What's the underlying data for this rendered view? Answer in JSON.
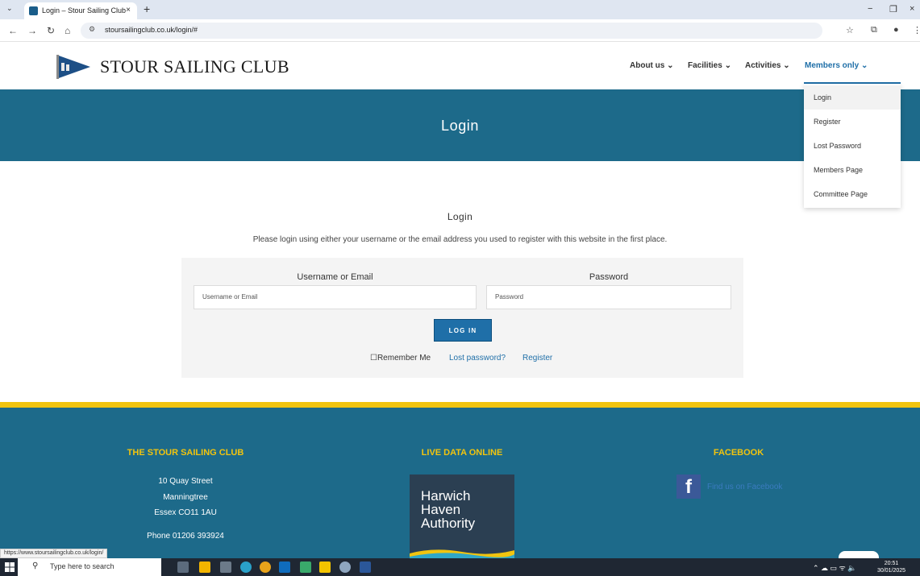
{
  "browser": {
    "tab_title": "Login – Stour Sailing Club",
    "tab_close": "×",
    "new_tab": "+",
    "url": "stoursailingclub.co.uk/login/#",
    "status_url": "https://www.stoursailingclub.co.uk/login/"
  },
  "site": {
    "logo_text": "STOUR SAILING CLUB",
    "nav": [
      {
        "label": "About us ⌄"
      },
      {
        "label": "Facilities ⌄"
      },
      {
        "label": "Activities ⌄"
      },
      {
        "label": "Members only ⌄"
      }
    ],
    "dropdown": [
      "Login",
      "Register",
      "Lost Password",
      "Members Page",
      "Committee Page"
    ],
    "hero_title": "Login"
  },
  "login": {
    "heading": "Login",
    "intro": "Please login using either your username or the email address you used to register with this website in the first place.",
    "username_label": "Username or Email",
    "username_placeholder": "Username or Email",
    "password_label": "Password",
    "password_placeholder": "Password",
    "button": "LOG IN",
    "remember": "☐Remember Me",
    "lost_password": "Lost password?",
    "register": "Register"
  },
  "footer": {
    "club_heading": "THE STOUR SAILING CLUB",
    "address": [
      "10 Quay Street",
      "Manningtree",
      "Essex CO11 1AU"
    ],
    "phone": "Phone 01206 393924",
    "live_heading": "LIVE DATA ONLINE",
    "hha_text": [
      "Harwich",
      "Haven",
      "Authority"
    ],
    "facebook_heading": "FACEBOOK",
    "facebook_link": "Find us on Facebook"
  },
  "taskbar": {
    "search_placeholder": "Type here to search",
    "time": "20:51",
    "date": "30/01/2025"
  },
  "colors": {
    "brand_blue": "#1d6a8a",
    "link_blue": "#1f6fa8",
    "accent_yellow": "#f1c40f"
  }
}
